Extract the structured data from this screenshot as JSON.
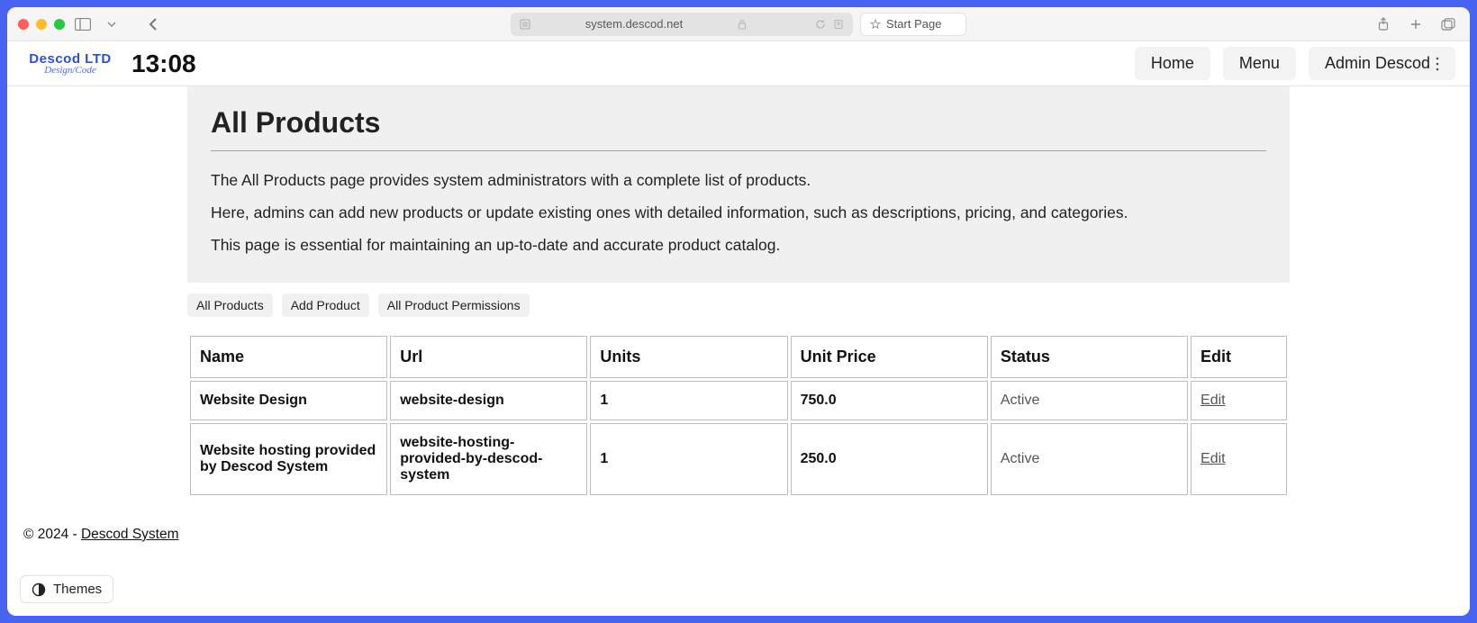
{
  "browser": {
    "url": "system.descod.net",
    "bookmark": "Start Page"
  },
  "header": {
    "logo": {
      "line1": "Descod LTD",
      "line2": "Design/Code"
    },
    "clock": "13:08",
    "nav": {
      "home": "Home",
      "menu": "Menu",
      "admin": "Admin Descod"
    }
  },
  "page": {
    "title": "All Products",
    "description": {
      "p1": "The All Products page provides system administrators with a complete list of products.",
      "p2": "Here, admins can add new products or update existing ones with detailed information, such as descriptions, pricing, and categories.",
      "p3": "This page is essential for maintaining an up-to-date and accurate product catalog."
    },
    "tabs": {
      "all": "All Products",
      "add": "Add Product",
      "perms": "All Product Permissions"
    },
    "table": {
      "headers": {
        "name": "Name",
        "url": "Url",
        "units": "Units",
        "price": "Unit Price",
        "status": "Status",
        "edit": "Edit"
      },
      "rows": [
        {
          "name": "Website Design",
          "url": "website-design",
          "units": "1",
          "price": "750.0",
          "status": "Active",
          "edit": "Edit"
        },
        {
          "name": "Website hosting provided by Descod System",
          "url": "website-hosting-provided-by-descod-system",
          "units": "1",
          "price": "250.0",
          "status": "Active",
          "edit": "Edit"
        }
      ]
    }
  },
  "footer": {
    "copyright": "© 2024 - ",
    "link": "Descod System"
  },
  "themes": {
    "label": "Themes"
  }
}
